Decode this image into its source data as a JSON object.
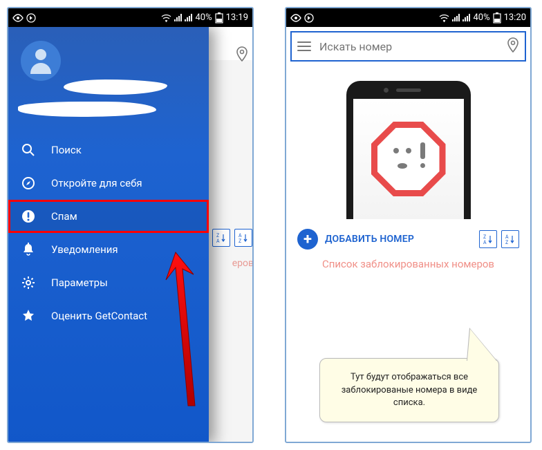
{
  "left": {
    "status": {
      "battery": "40%",
      "time": "13:19"
    },
    "menu": {
      "search": "Поиск",
      "discover": "Откройте для себя",
      "spam": "Спам",
      "notifications": "Уведомления",
      "settings": "Параметры",
      "rate": "Оценить GetContact"
    },
    "behind_text": "еров"
  },
  "right": {
    "status": {
      "battery": "40%",
      "time": "13:20"
    },
    "search_placeholder": "Искать номер",
    "add_number": "ДОБАВИТЬ НОМЕР",
    "sort_za": "Z↓\nA",
    "sort_az": "A↓\nZ",
    "blocked_list": "Список заблокированных номеров",
    "callout": "Тут будут отображаться все заблокированые номера в виде списка."
  }
}
